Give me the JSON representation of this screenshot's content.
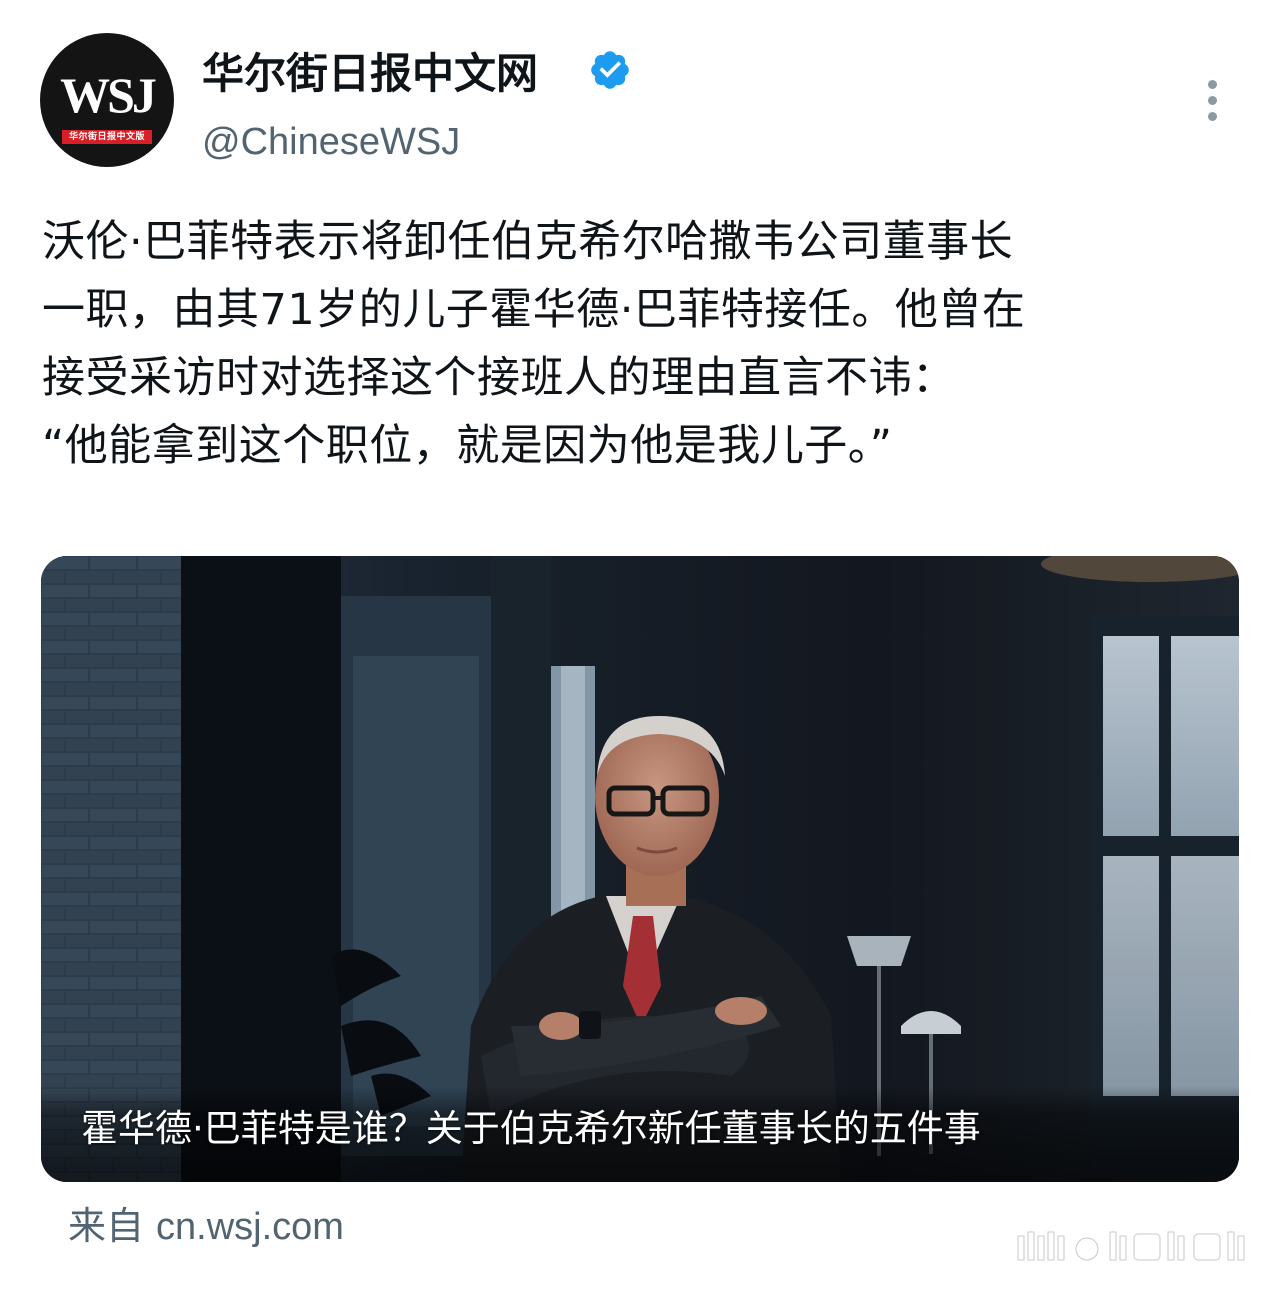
{
  "account": {
    "avatar_text": "WSJ",
    "avatar_subtext": "华尔街日报中文版",
    "display_name": "华尔街日报中文网",
    "handle": "@ChineseWSJ",
    "verified": true,
    "verified_icon": "verified-badge-icon",
    "more_icon": "more-vertical-icon"
  },
  "tweet": {
    "lines": [
      "沃伦·巴菲特表示将卸任伯克希尔哈撒韦公司董事长",
      "一职，由其71岁的儿子霍华德·巴菲特接任。他曾在",
      "接受采访时对选择这个接班人的理由直言不讳：",
      "“他能拿到这个职位，就是因为他是我儿子。”"
    ]
  },
  "media": {
    "caption": "霍华德·巴菲特是谁？关于伯克希尔新任董事长的五件事"
  },
  "source": {
    "prefix": "来自",
    "domain": "cn.wsj.com"
  },
  "colors": {
    "text_primary": "#0f1419",
    "text_secondary": "#536471",
    "verified_blue": "#1d9bf0",
    "avatar_bg": "#141414",
    "avatar_band": "#d61f26"
  }
}
